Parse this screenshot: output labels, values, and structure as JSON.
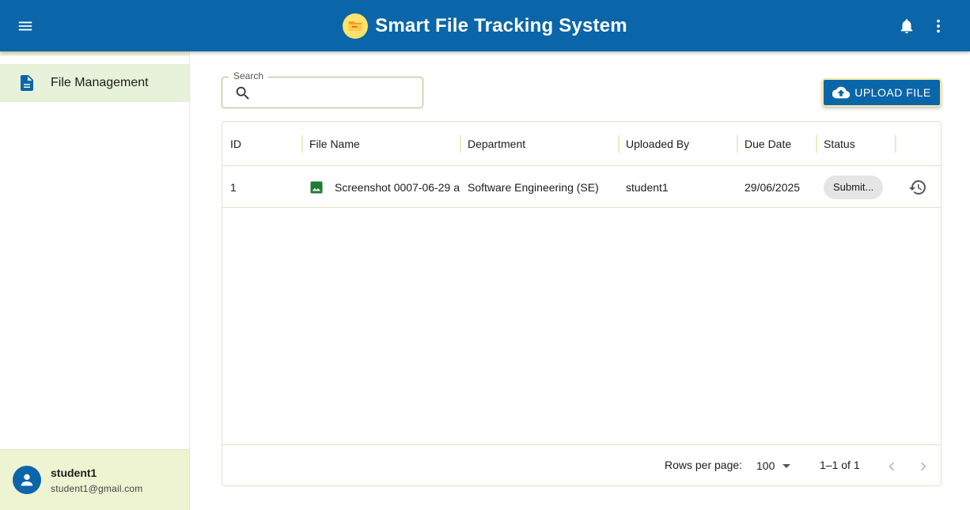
{
  "app": {
    "title": "Smart File Tracking System",
    "brand_color": "#0a66a8"
  },
  "icons": {
    "menu": "menu-icon",
    "logo": "folder-logo-icon",
    "notifications": "bell-icon",
    "more": "more-vert-icon",
    "nav_file": "description-icon",
    "search": "search-icon",
    "upload": "cloud-upload-icon",
    "file_type": "image-icon",
    "history": "history-icon",
    "prev": "chevron-left-icon",
    "next": "chevron-right-icon",
    "avatar": "person-icon"
  },
  "sidebar": {
    "items": [
      {
        "label": "File Management",
        "active": true
      }
    ],
    "user": {
      "name": "student1",
      "email": "student1@gmail.com"
    }
  },
  "search": {
    "label": "Search",
    "value": "",
    "placeholder": ""
  },
  "toolbar": {
    "upload_label": "UPLOAD FILE"
  },
  "table": {
    "columns": [
      "ID",
      "File Name",
      "Department",
      "Uploaded By",
      "Due Date",
      "Status"
    ],
    "rows": [
      {
        "id": "1",
        "file_name": "Screenshot 0007-06-29 a",
        "department": "Software Engineering (SE)",
        "uploaded_by": "student1",
        "due_date": "29/06/2025",
        "status": "Submit..."
      }
    ]
  },
  "pagination": {
    "rows_per_page_label": "Rows per page:",
    "rows_per_page": "100",
    "range": "1–1 of 1"
  }
}
